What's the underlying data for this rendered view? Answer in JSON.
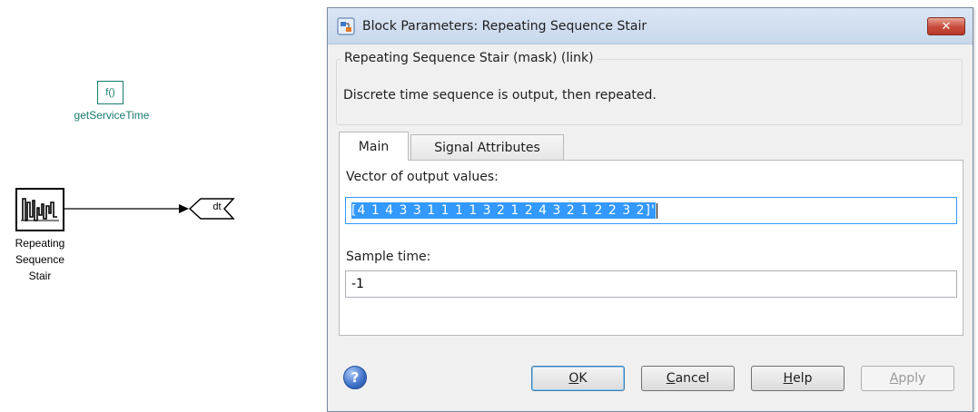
{
  "canvas": {
    "fn_block": {
      "text": "f()",
      "label": "getServiceTime"
    },
    "stair_block": {
      "label_lines": [
        "Repeating",
        "Sequence",
        "Stair"
      ]
    },
    "goto_block": {
      "text": "dt"
    }
  },
  "dialog": {
    "title": "Block Parameters: Repeating Sequence Stair",
    "close_label": "✕",
    "group_legend": "Repeating Sequence Stair (mask) (link)",
    "description": "Discrete time sequence is output, then repeated.",
    "tabs": [
      {
        "label": "Main",
        "active": true
      },
      {
        "label": "Signal Attributes",
        "active": false
      }
    ],
    "fields": {
      "vector_label": "Vector of output values:",
      "vector_value": "[4 1 4 3 3 1 1 1 1 3 2 1 2 4 3 2 1 2 2 3 2]'",
      "sample_time_label": "Sample time:",
      "sample_time_value": "-1"
    },
    "buttons": {
      "ok": {
        "mnemonic": "O",
        "rest": "K"
      },
      "cancel": {
        "mnemonic": "C",
        "rest": "ancel"
      },
      "help": {
        "mnemonic": "H",
        "rest": "elp"
      },
      "apply": {
        "mnemonic": "A",
        "rest": "pply",
        "enabled": false
      }
    },
    "help_icon": "question-icon"
  },
  "colors": {
    "accent_teal": "#1a7d6e",
    "selection_blue": "#3399ff",
    "close_red": "#c74a3a"
  }
}
